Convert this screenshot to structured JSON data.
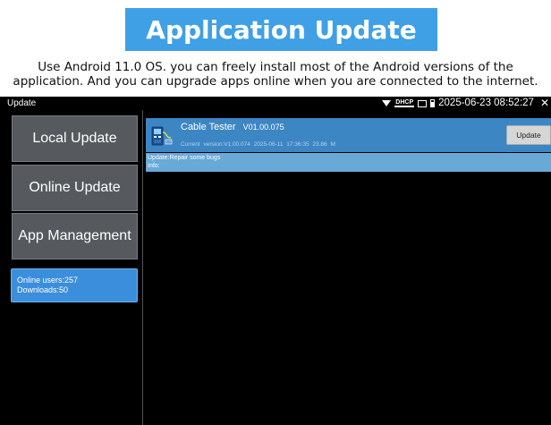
{
  "banner": {
    "title": "Application Update"
  },
  "description": {
    "line1": "Use Android 11.0 OS. you can freely install most of the Android versions of the",
    "line2": "application. And you can upgrade apps online when you are connected to the internet."
  },
  "statusbar": {
    "title": "Update",
    "dhcp_label": "DHCP",
    "clock": "2025-06-23 08:52:27",
    "icons": [
      "wifi-icon",
      "dhcp-icon",
      "screen-icon",
      "battery-icon",
      "close-icon"
    ]
  },
  "sidebar": {
    "items": [
      {
        "label": "Local Update"
      },
      {
        "label": "Online Update"
      },
      {
        "label": "App Management"
      }
    ],
    "stats": {
      "online_users": "Online users:257",
      "downloads": "Downloads:50"
    }
  },
  "app": {
    "icon": "cable-tester-icon",
    "name": "Cable Tester",
    "version": "V01.00.075",
    "current_version": "Current version:V1.00.074",
    "date": "2025-06-11 17:36:35",
    "size": "23.86 M",
    "update_button": "Update",
    "update_note": "Update:Repair some bugs",
    "info": "Info:"
  },
  "colors": {
    "banner": "#3fa0e6",
    "stats_box": "#3b8edb",
    "app_card": "#3d86c4",
    "info_box": "#68a9d8",
    "side_button": "#565a5e"
  }
}
